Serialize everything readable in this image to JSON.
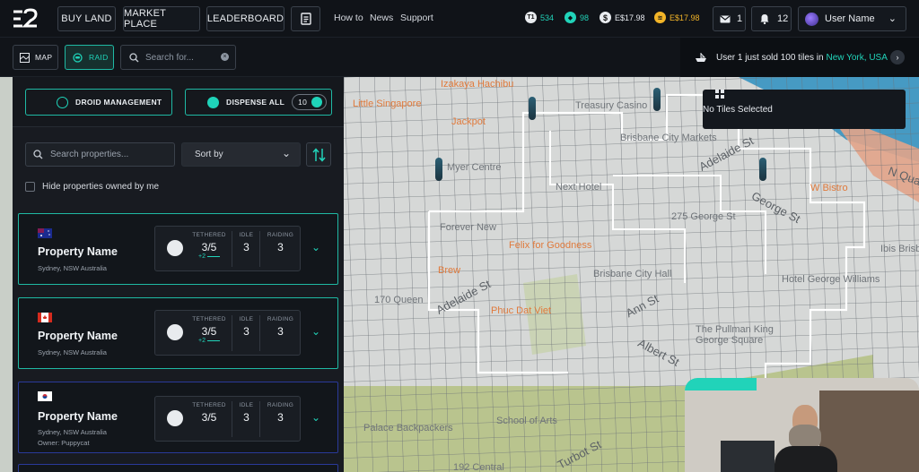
{
  "topbar": {
    "nav": [
      "BUY LAND",
      "MARKET PLACE",
      "LEADERBOARD"
    ],
    "links": [
      "How to",
      "News",
      "Support"
    ],
    "stats": [
      {
        "icon": "t1-icon",
        "label": "T1",
        "value": "534",
        "color": "#21d3b9"
      },
      {
        "icon": "gem-icon",
        "value": "98",
        "color": "#21d3b9"
      },
      {
        "icon": "dollar-icon",
        "value": "E$17.98",
        "color": "#e6e9ee"
      },
      {
        "icon": "gold-coin-icon",
        "value": "E$17.98",
        "color": "#f2b428"
      }
    ],
    "mail_count": "1",
    "notif_count": "12",
    "user_name": "User Name"
  },
  "subbar": {
    "map_label": "MAP",
    "raid_label": "RAID",
    "search_placeholder": "Search for...",
    "ticker_prefix": "User 1 just sold 100 tiles in ",
    "ticker_city": "New York, USA"
  },
  "sidebar": {
    "droid_management": "DROID MANAGEMENT",
    "dispense_all": "DISPENSE ALL",
    "dispense_count": "10",
    "search_placeholder": "Search properties...",
    "sort_label": "Sort by",
    "hide_label": "Hide properties owned by me",
    "headers": {
      "tethered": "TETHERED",
      "idle": "IDLE",
      "raiding": "RAIDING"
    },
    "properties": [
      {
        "flag": "australia",
        "name": "Property Name",
        "location": "Sydney, NSW Australia",
        "owner": "",
        "tethered": "3/5",
        "plus": "+2",
        "idle": "3",
        "raiding": "3",
        "style": "teal"
      },
      {
        "flag": "canada",
        "name": "Property Name",
        "location": "Sydney, NSW Australia",
        "owner": "",
        "tethered": "3/5",
        "plus": "+2",
        "idle": "3",
        "raiding": "3",
        "style": "teal"
      },
      {
        "flag": "south-korea",
        "name": "Property Name",
        "location": "Sydney, NSW Australia",
        "owner": "Owner: Puppycat",
        "tethered": "3/5",
        "plus": "",
        "idle": "3",
        "raiding": "3",
        "style": "blue"
      }
    ]
  },
  "map": {
    "no_tiles": "No Tiles Selected",
    "labels": [
      {
        "text": "Izakaya Hachibu",
        "kind": "poi"
      },
      {
        "text": "Little Singapore",
        "kind": "poi"
      },
      {
        "text": "Jackpot",
        "kind": "poi"
      },
      {
        "text": "Treasury Casino",
        "kind": "place"
      },
      {
        "text": "Brisbane City Markets",
        "kind": "place"
      },
      {
        "text": "Myer Centre",
        "kind": "place"
      },
      {
        "text": "Next Hotel",
        "kind": "place"
      },
      {
        "text": "Adelaide St",
        "kind": "street"
      },
      {
        "text": "W Bistro",
        "kind": "poi"
      },
      {
        "text": "N Quay",
        "kind": "street"
      },
      {
        "text": "George St",
        "kind": "street"
      },
      {
        "text": "275 George St",
        "kind": "place"
      },
      {
        "text": "Forever New",
        "kind": "place"
      },
      {
        "text": "Felix for Goodness",
        "kind": "poi"
      },
      {
        "text": "Ibis Brisbane",
        "kind": "place"
      },
      {
        "text": "Brew",
        "kind": "poi"
      },
      {
        "text": "Brisbane City Hall",
        "kind": "place"
      },
      {
        "text": "Hotel George Williams",
        "kind": "place"
      },
      {
        "text": "170 Queen",
        "kind": "place"
      },
      {
        "text": "Adelaide St",
        "kind": "street"
      },
      {
        "text": "Phuc Dat Viet",
        "kind": "poi"
      },
      {
        "text": "Ann St",
        "kind": "street"
      },
      {
        "text": "The Pullman King George Square",
        "kind": "place"
      },
      {
        "text": "Albert St",
        "kind": "street"
      },
      {
        "text": "Palace Backpackers",
        "kind": "place"
      },
      {
        "text": "School of Arts",
        "kind": "place"
      },
      {
        "text": "Turbot St",
        "kind": "street"
      },
      {
        "text": "192 Central",
        "kind": "place"
      }
    ]
  }
}
